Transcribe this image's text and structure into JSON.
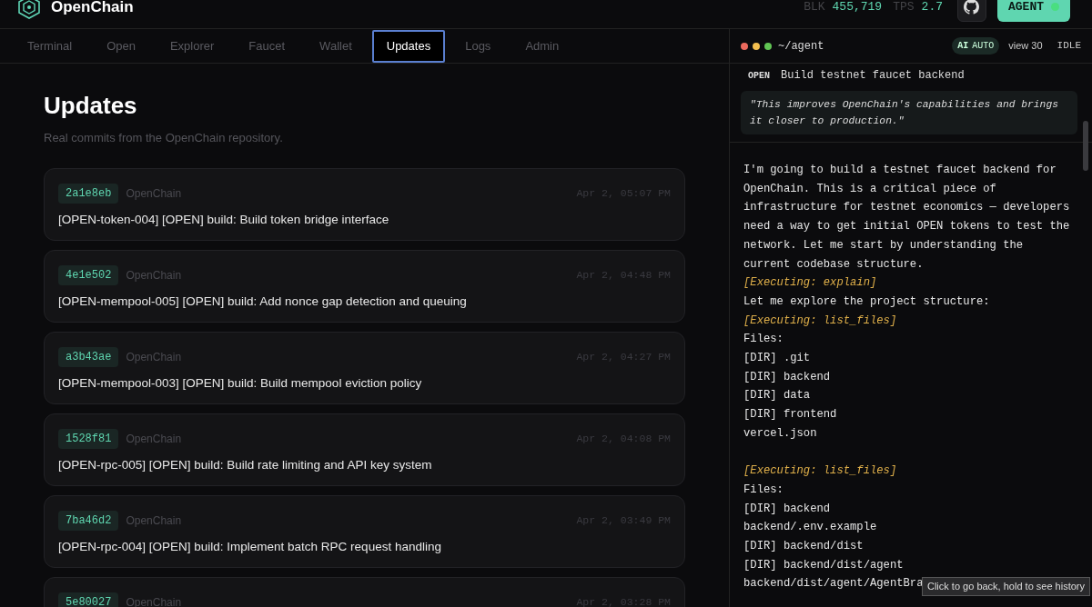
{
  "header": {
    "brand": "OpenChain",
    "stats": [
      {
        "label": "BLK",
        "value": "455,719"
      },
      {
        "label": "TPS",
        "value": "2.7"
      }
    ],
    "agent_button": {
      "label": "AGENT"
    }
  },
  "tabs": [
    {
      "label": "Terminal",
      "selected": false
    },
    {
      "label": "Open",
      "selected": false
    },
    {
      "label": "Explorer",
      "selected": false
    },
    {
      "label": "Faucet",
      "selected": false
    },
    {
      "label": "Wallet",
      "selected": false
    },
    {
      "label": "Updates",
      "selected": true
    },
    {
      "label": "Logs",
      "selected": false
    },
    {
      "label": "Admin",
      "selected": false
    }
  ],
  "updates": {
    "title": "Updates",
    "subtitle": "Real commits from the OpenChain repository.",
    "commits": [
      {
        "hash": "2a1e8eb",
        "repo": "OpenChain",
        "date": "Apr 2, 05:07 PM",
        "message": "[OPEN-token-004] [OPEN] build: Build token bridge interface"
      },
      {
        "hash": "4e1e502",
        "repo": "OpenChain",
        "date": "Apr 2, 04:48 PM",
        "message": "[OPEN-mempool-005] [OPEN] build: Add nonce gap detection and queuing"
      },
      {
        "hash": "a3b43ae",
        "repo": "OpenChain",
        "date": "Apr 2, 04:27 PM",
        "message": "[OPEN-mempool-003] [OPEN] build: Build mempool eviction policy"
      },
      {
        "hash": "1528f81",
        "repo": "OpenChain",
        "date": "Apr 2, 04:08 PM",
        "message": "[OPEN-rpc-005] [OPEN] build: Build rate limiting and API key system"
      },
      {
        "hash": "7ba46d2",
        "repo": "OpenChain",
        "date": "Apr 2, 03:49 PM",
        "message": "[OPEN-rpc-004] [OPEN] build: Implement batch RPC request handling"
      },
      {
        "hash": "5e80027",
        "repo": "OpenChain",
        "date": "Apr 2, 03:28 PM"
      }
    ]
  },
  "agent": {
    "path": "~/agent",
    "mode_badge": {
      "strong": "AI",
      "text": "AUTO"
    },
    "view": "view 30",
    "status": "IDLE",
    "task": {
      "tag": "OPEN",
      "title": "Build testnet faucet backend",
      "quote": "\"This improves OpenChain's capabilities and brings it closer to production.\""
    },
    "lines": [
      {
        "kind": "text",
        "text": "I'm going to build a testnet faucet backend for OpenChain. This is a critical piece of infrastructure for testnet economics — developers need a way to get initial OPEN tokens to test the network. Let me start by understanding the current codebase structure."
      },
      {
        "kind": "exec",
        "text": "[Executing: explain]"
      },
      {
        "kind": "text",
        "text": "Let me explore the project structure:"
      },
      {
        "kind": "exec",
        "text": "[Executing: list_files]"
      },
      {
        "kind": "text",
        "text": "Files:"
      },
      {
        "kind": "text",
        "text": "[DIR] .git"
      },
      {
        "kind": "text",
        "text": "[DIR] backend"
      },
      {
        "kind": "text",
        "text": "[DIR] data"
      },
      {
        "kind": "text",
        "text": "[DIR] frontend"
      },
      {
        "kind": "text",
        "text": "vercel.json"
      },
      {
        "kind": "gap"
      },
      {
        "kind": "exec",
        "text": "[Executing: list_files]"
      },
      {
        "kind": "text",
        "text": "Files:"
      },
      {
        "kind": "text",
        "text": "[DIR] backend"
      },
      {
        "kind": "text",
        "text": "backend/.env.example"
      },
      {
        "kind": "text",
        "text": "[DIR] backend/dist"
      },
      {
        "kind": "text",
        "text": "[DIR] backend/dist/agent"
      },
      {
        "kind": "text",
        "text": "backend/dist/agent/AgentBra"
      }
    ]
  },
  "tooltip": "Click to go back, hold to see history"
}
